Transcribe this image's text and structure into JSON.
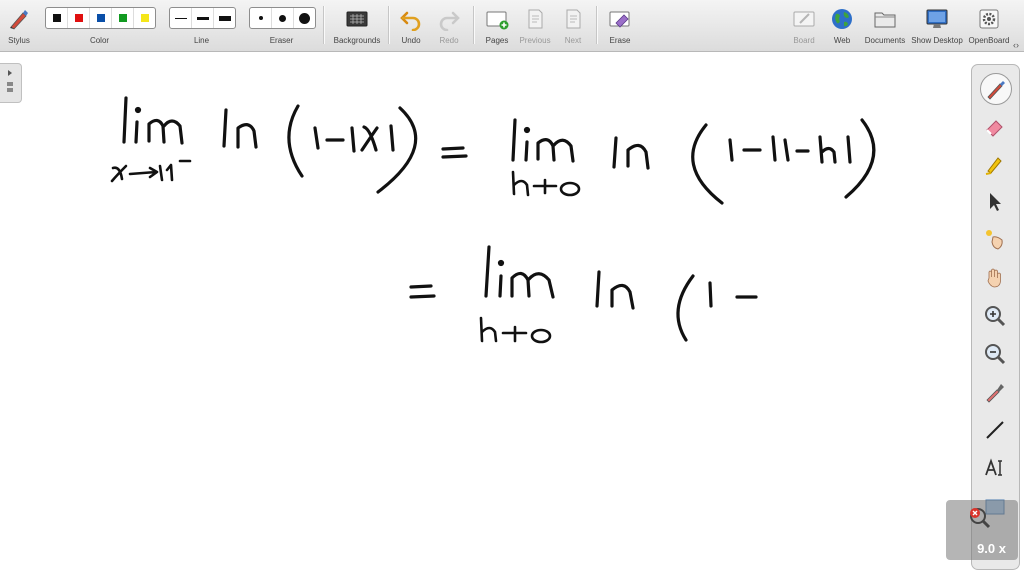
{
  "toolbar": {
    "stylus_label": "Stylus",
    "color_label": "Color",
    "line_label": "Line",
    "eraser_label": "Eraser",
    "backgrounds_label": "Backgrounds",
    "undo_label": "Undo",
    "redo_label": "Redo",
    "pages_label": "Pages",
    "previous_label": "Previous",
    "next_label": "Next",
    "erase_label": "Erase",
    "board_label": "Board",
    "web_label": "Web",
    "documents_label": "Documents",
    "show_desktop_label": "Show Desktop",
    "openboard_label": "OpenBoard"
  },
  "colors": [
    "#111111",
    "#e01010",
    "#0a4fa8",
    "#129a21",
    "#f5e61a"
  ],
  "sidebar": {
    "tools": [
      "pen-icon",
      "eraser-icon",
      "highlighter-icon",
      "pointer-icon",
      "laser-pointer-icon",
      "hand-icon",
      "zoom-in-icon",
      "zoom-out-icon",
      "color-picker-icon",
      "line-icon",
      "text-icon",
      "capture-icon"
    ]
  },
  "zoom": {
    "level_text": "9.0 x"
  },
  "ink_color": "#111111"
}
